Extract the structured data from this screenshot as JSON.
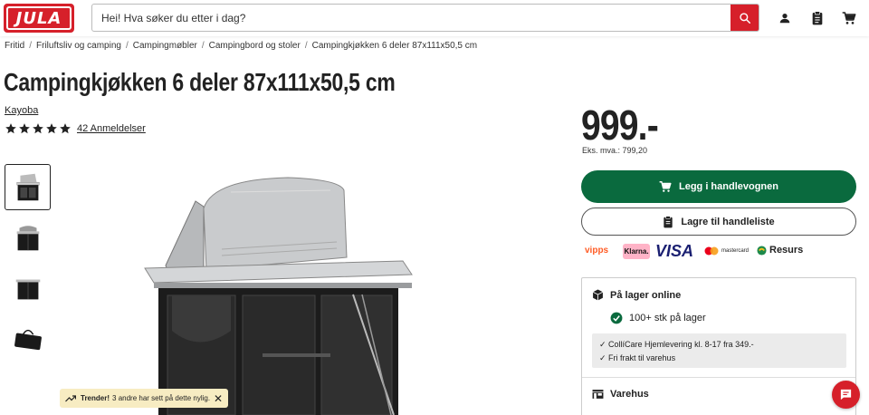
{
  "header": {
    "logo_text": "JULA",
    "search_placeholder": "Hei! Hva søker du etter i dag?",
    "icons": [
      "search-icon",
      "user-icon",
      "clipboard-icon",
      "cart-icon"
    ],
    "accent": "#d6202a"
  },
  "breadcrumb": [
    "Fritid",
    "Friluftsliv og camping",
    "Campingmøbler",
    "Campingbord og stoler",
    "Campingkjøkken 6 deler 87x111x50,5 cm"
  ],
  "product": {
    "title": "Campingkjøkken 6 deler 87x111x50,5 cm",
    "brand": "Kayoba",
    "rating": 5,
    "reviews": "42 Anmeldelser",
    "price": "999.-",
    "vat_text": "Eks. mva.: 799,20"
  },
  "actions": {
    "add_to_cart": "Legg i handlevognen",
    "save_list": "Lagre til handleliste",
    "cart_color": "#0a6a3e"
  },
  "payments": [
    "vipps",
    "Klarna.",
    "VISA",
    "mastercard",
    "Resurs"
  ],
  "stock": {
    "online_title": "På lager online",
    "online_status": "100+ stk på lager",
    "delivery": [
      "CollíCare Hjemlevering kl. 8-17 fra 349.-",
      "Fri frakt til varehus"
    ],
    "store_title": "Varehus"
  },
  "toast": {
    "bold": "Trender!",
    "text": "3 andre har sett på dette nylig."
  }
}
